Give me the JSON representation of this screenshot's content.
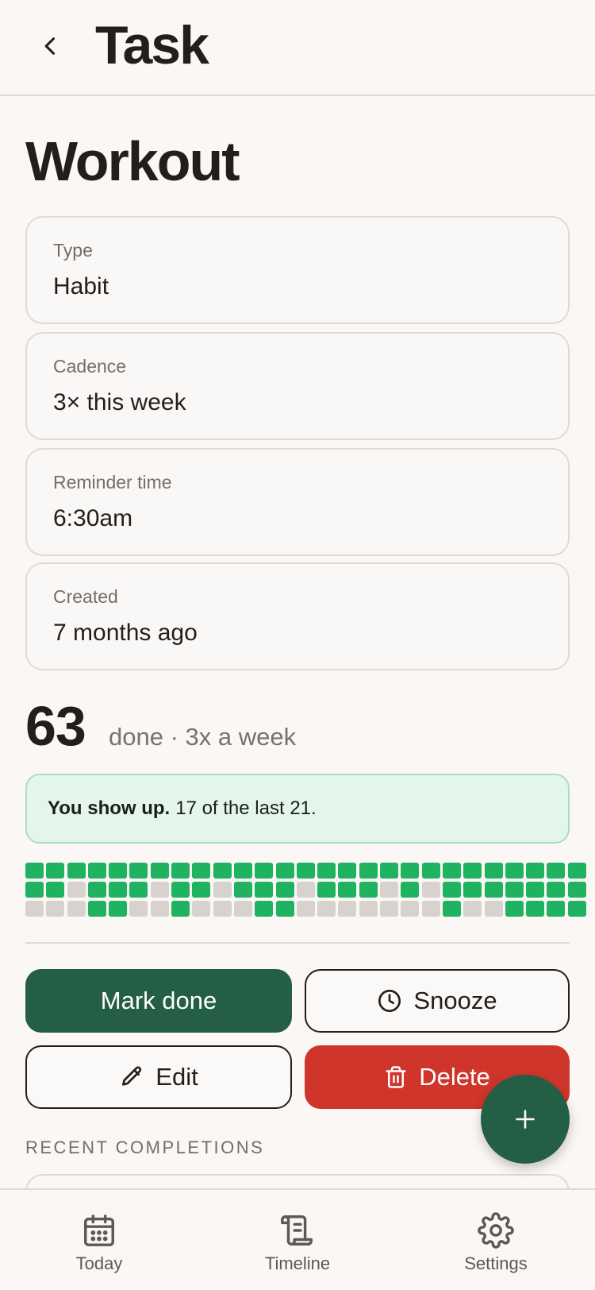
{
  "header": {
    "title": "Task",
    "back_icon": "chevron-left-icon"
  },
  "task": {
    "title": "Workout"
  },
  "fields": [
    {
      "label": "Type",
      "value": "Habit"
    },
    {
      "label": "Cadence",
      "value": "3× this week"
    },
    {
      "label": "Reminder time",
      "value": "6:30am"
    },
    {
      "label": "Created",
      "value": "7 months ago"
    }
  ],
  "stats": {
    "count": "63",
    "subtitle": "done · 3x a week",
    "note_bold": "You show up.",
    "note_rest": "17 of the last 21."
  },
  "history": {
    "rows": [
      [
        1,
        1,
        1,
        1,
        1,
        1,
        1,
        1,
        1,
        1,
        1,
        1,
        1,
        1,
        1,
        1,
        1,
        1,
        1,
        1,
        1,
        1,
        1,
        1,
        1,
        1,
        1
      ],
      [
        1,
        1,
        0,
        1,
        1,
        1,
        0,
        1,
        1,
        0,
        1,
        1,
        1,
        0,
        1,
        1,
        1,
        0,
        1,
        0,
        1,
        1,
        1,
        1,
        1,
        1,
        1
      ],
      [
        0,
        0,
        0,
        1,
        1,
        0,
        0,
        1,
        0,
        0,
        0,
        1,
        1,
        0,
        0,
        0,
        0,
        0,
        0,
        0,
        1,
        0,
        0,
        1,
        1,
        1,
        1
      ]
    ],
    "on_color": "#1fb361",
    "off_color": "#d7d2ce"
  },
  "actions": {
    "mark_done": "Mark done",
    "snooze": "Snooze",
    "edit": "Edit",
    "delete": "Delete",
    "snooze_icon": "clock-icon",
    "edit_icon": "pencil-icon",
    "delete_icon": "trash-icon"
  },
  "recent": {
    "section_label": "RECENT COMPLETIONS"
  },
  "fab": {
    "icon": "plus-icon"
  },
  "nav": {
    "items": [
      {
        "label": "Today",
        "icon": "calendar-icon"
      },
      {
        "label": "Timeline",
        "icon": "scroll-icon"
      },
      {
        "label": "Settings",
        "icon": "gear-icon"
      }
    ]
  },
  "colors": {
    "primary": "#235e45",
    "danger": "#cf352b",
    "background": "#faf7f5",
    "accent_green": "#1fb361"
  }
}
